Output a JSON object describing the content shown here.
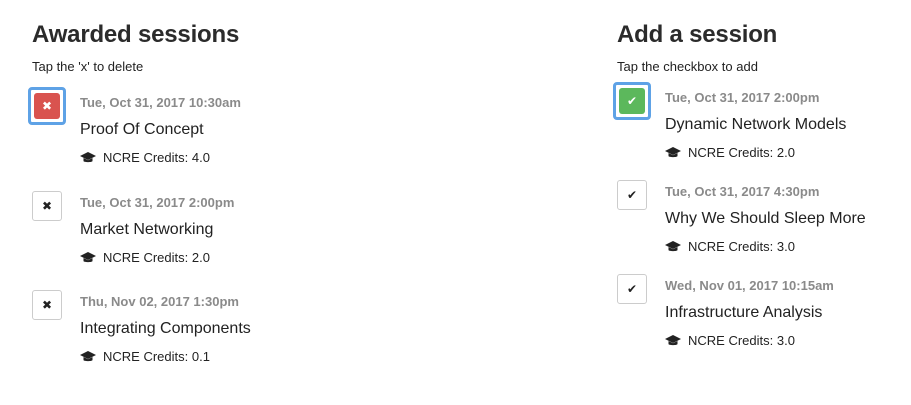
{
  "awarded": {
    "heading": "Awarded sessions",
    "hint": "Tap the 'x' to delete",
    "sessions": [
      {
        "date": "Tue, Oct 31, 2017 10:30am",
        "title": "Proof Of Concept",
        "credits": "NCRE Credits: 4.0",
        "action_icon": "close-icon",
        "focused": true,
        "box_color": "#d9534f"
      },
      {
        "date": "Tue, Oct 31, 2017 2:00pm",
        "title": "Market Networking",
        "credits": "NCRE Credits: 2.0",
        "action_icon": "close-icon",
        "focused": false
      },
      {
        "date": "Thu, Nov 02, 2017 1:30pm",
        "title": "Integrating Components",
        "credits": "NCRE Credits: 0.1",
        "action_icon": "close-icon",
        "focused": false
      }
    ]
  },
  "add": {
    "heading": "Add a session",
    "hint": "Tap the checkbox to add",
    "sessions": [
      {
        "date": "Tue, Oct 31, 2017 2:00pm",
        "title": "Dynamic Network Models",
        "credits": "NCRE Credits: 2.0",
        "action_icon": "check-icon",
        "focused": true,
        "box_color": "#5cb85c"
      },
      {
        "date": "Tue, Oct 31, 2017 4:30pm",
        "title": "Why We Should Sleep More",
        "credits": "NCRE Credits: 3.0",
        "action_icon": "check-icon",
        "focused": false
      },
      {
        "date": "Wed, Nov 01, 2017 10:15am",
        "title": "Infrastructure Analysis",
        "credits": "NCRE Credits: 3.0",
        "action_icon": "check-icon",
        "focused": false
      }
    ]
  },
  "colors": {
    "focus_ring": "#5ea2e6",
    "date_text": "#8a8a8a"
  },
  "icons": {
    "credits": "graduation-cap-icon"
  }
}
